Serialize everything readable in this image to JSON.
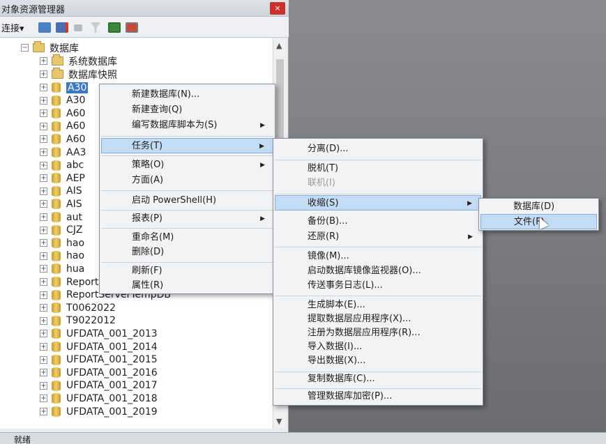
{
  "window": {
    "title": "对象资源管理器",
    "close_glyph": "×"
  },
  "toolbar": {
    "connect_label": "连接▾"
  },
  "tree": {
    "root_label": "数据库",
    "folders": [
      "系统数据库",
      "数据库快照"
    ],
    "databases": [
      "A30",
      "A30",
      "A60",
      "A60",
      "A60",
      "AA3",
      "abc",
      "AEP",
      "AIS",
      "AIS",
      "aut",
      "CJZ",
      "hao",
      "hao",
      "hua",
      "ReportServer",
      "ReportServerTempDB",
      "T0062022",
      "T9022012",
      "UFDATA_001_2013",
      "UFDATA_001_2014",
      "UFDATA_001_2015",
      "UFDATA_001_2016",
      "UFDATA_001_2017",
      "UFDATA_001_2018",
      "UFDATA_001_2019"
    ]
  },
  "status": {
    "text": "就绪"
  },
  "context_menu": {
    "items": {
      "new_db": "新建数据库(N)...",
      "new_query": "新建查询(Q)",
      "script_db": "编写数据库脚本为(S)",
      "tasks": "任务(T)",
      "policies": "策略(O)",
      "facets": "方面(A)",
      "powershell": "启动 PowerShell(H)",
      "reports": "报表(P)",
      "rename": "重命名(M)",
      "delete": "删除(D)",
      "refresh": "刷新(F)",
      "properties": "属性(R)"
    }
  },
  "tasks_menu": {
    "items": {
      "detach": "分离(D)...",
      "offline": "脱机(T)",
      "online": "联机(I)",
      "shrink": "收缩(S)",
      "backup": "备份(B)...",
      "restore": "还原(R)",
      "mirror": "镜像(M)...",
      "mirror_monitor": "启动数据库镜像监视器(O)...",
      "ship_logs": "传送事务日志(L)...",
      "gen_scripts": "生成脚本(E)...",
      "extract_dac": "提取数据层应用程序(X)...",
      "register_dac": "注册为数据层应用程序(R)...",
      "import": "导入数据(I)...",
      "export": "导出数据(X)...",
      "copy_db": "复制数据库(C)...",
      "manage_encryption": "管理数据库加密(P)..."
    }
  },
  "shrink_menu": {
    "items": {
      "database": "数据库(D)",
      "files": "文件(F)"
    }
  },
  "arrow_glyph": "▶"
}
